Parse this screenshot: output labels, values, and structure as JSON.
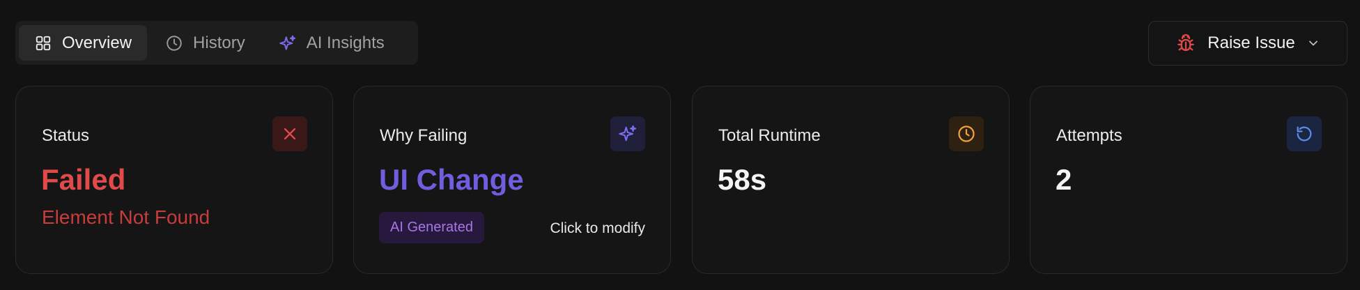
{
  "tabs": [
    {
      "label": "Overview",
      "icon": "grid-icon",
      "active": true
    },
    {
      "label": "History",
      "icon": "clock-icon",
      "active": false
    },
    {
      "label": "AI Insights",
      "icon": "sparkle-icon",
      "active": false
    }
  ],
  "raise_issue": {
    "label": "Raise Issue",
    "icon": "bug-icon"
  },
  "cards": {
    "status": {
      "label": "Status",
      "value": "Failed",
      "sub": "Element Not Found",
      "icon": "close-icon",
      "color": "#e24a4a"
    },
    "why_failing": {
      "label": "Why Failing",
      "value": "UI Change",
      "badge": "AI Generated",
      "action": "Click to modify",
      "icon": "sparkle-icon",
      "color": "#6f5fe0"
    },
    "runtime": {
      "label": "Total Runtime",
      "value": "58s",
      "icon": "clock-icon",
      "color": "#f0a33a"
    },
    "attempts": {
      "label": "Attempts",
      "value": "2",
      "icon": "refresh-icon",
      "color": "#5b8def"
    }
  }
}
